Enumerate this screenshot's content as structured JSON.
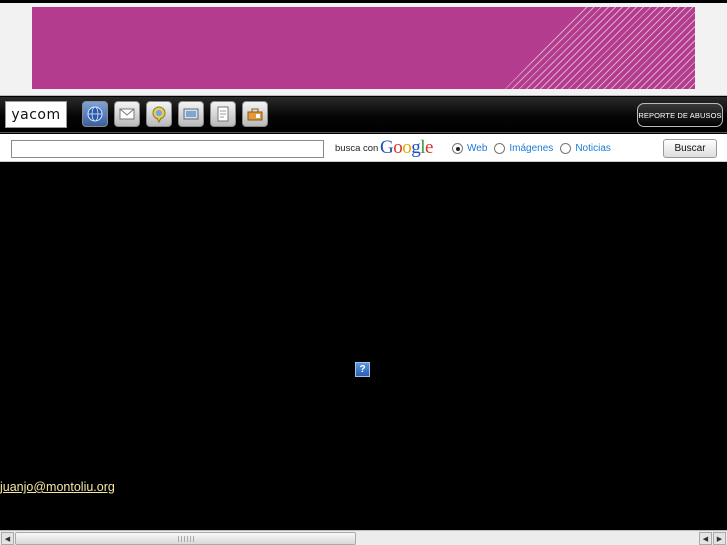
{
  "toolbar": {
    "logo_text": "yacom",
    "icons": [
      "globe-icon",
      "mail-icon",
      "chat-icon",
      "photo-icon",
      "document-icon",
      "briefcase-icon"
    ],
    "report_label": "REPORTE DE ABUSOS"
  },
  "search": {
    "value": "",
    "busca_con": "busca con",
    "google": [
      "G",
      "o",
      "o",
      "g",
      "l",
      "e"
    ],
    "google_colors": [
      "#1f4fbf",
      "#d8352a",
      "#e8a800",
      "#1f4fbf",
      "#2b9a3a",
      "#d8352a"
    ],
    "options": [
      {
        "label": "Web",
        "checked": true
      },
      {
        "label": "Imágenes",
        "checked": false
      },
      {
        "label": "Noticias",
        "checked": false
      }
    ],
    "button_label": "Buscar"
  },
  "content": {
    "plugin_icon": "?",
    "email": "juanjo@montoliu.org"
  },
  "colors": {
    "banner": "#b43c8f",
    "link": "#f3e7a0",
    "radio_label": "#1a7bd6"
  }
}
